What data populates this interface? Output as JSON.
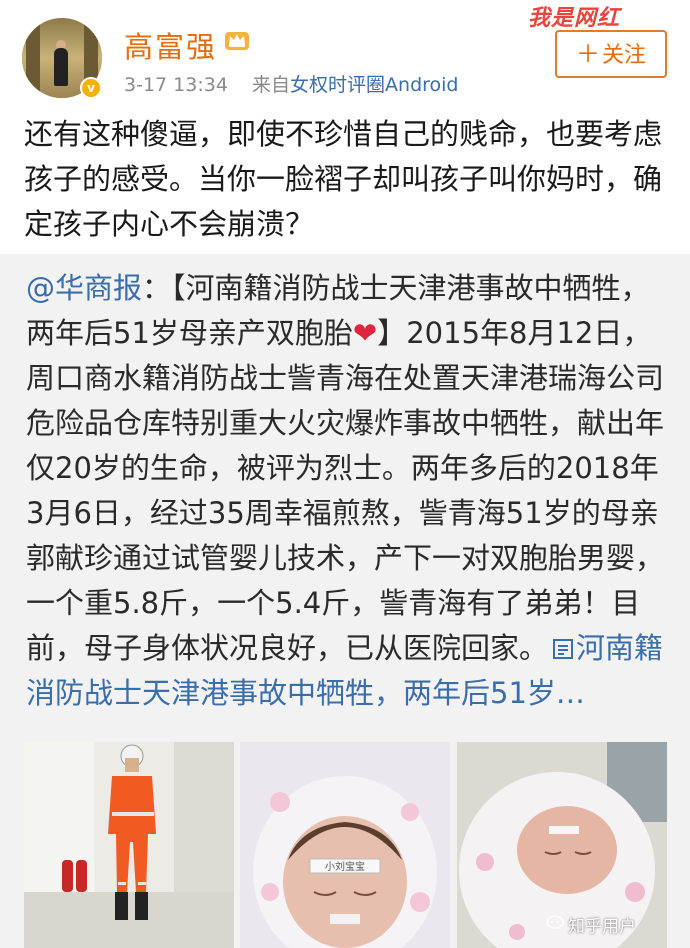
{
  "header": {
    "username": "高富强",
    "timestamp": "3-17 13:34",
    "source_prefix": "来自",
    "source_name": "女权时评圈Android",
    "follow_label": "关注",
    "follow_plus": "＋",
    "verified_badge": "v",
    "top_watermark": "我是网红",
    "icons": {
      "verified": "verified-v-icon",
      "crown": "crown-vip-icon",
      "plus": "plus-icon"
    },
    "colors": {
      "username": "#e86c0a",
      "source_link": "#3a6dab",
      "follow_border": "#e37b2e"
    }
  },
  "post": {
    "text": "还有这种傻逼，即使不珍惜自己的贱命，也要考虑孩子的感受。当你一脸褶子却叫孩子叫你妈时，确定孩子内心不会崩溃？"
  },
  "retweet": {
    "mention": "@华商报",
    "colon": "：",
    "body_part1": "【河南籍消防战士天津港事故中牺牲，两年后51岁母亲产双胞胎",
    "heart": "❤",
    "body_part2": "】2015年8月12日，周口商水籍消防战士訾青海在处置天津港瑞海公司危险品仓库特别重大火灾爆炸事故中牺牲，献出年仅20岁的生命，被评为烈士。两年多后的2018年3月6日，经过35周幸福煎熬，訾青海51岁的母亲郭献珍通过试管婴儿技术，产下一对双胞胎男婴，一个重5.8斤，一个5.4斤，訾青海有了弟弟！目前，母子身体状况良好，已从医院回家。",
    "link_icon": "article-icon",
    "link_text": "河南籍消防战士天津港事故中牺牲，两年后51岁…",
    "colors": {
      "link": "#3a6dab",
      "heart": "#e0243c",
      "background": "#f2f2f2"
    }
  },
  "images": [
    {
      "name": "firefighter-photo"
    },
    {
      "name": "newborn-photo-1",
      "forehead_label": "小刘宝宝"
    },
    {
      "name": "newborn-photo-2"
    }
  ],
  "bottom_watermark": "知乎用户"
}
